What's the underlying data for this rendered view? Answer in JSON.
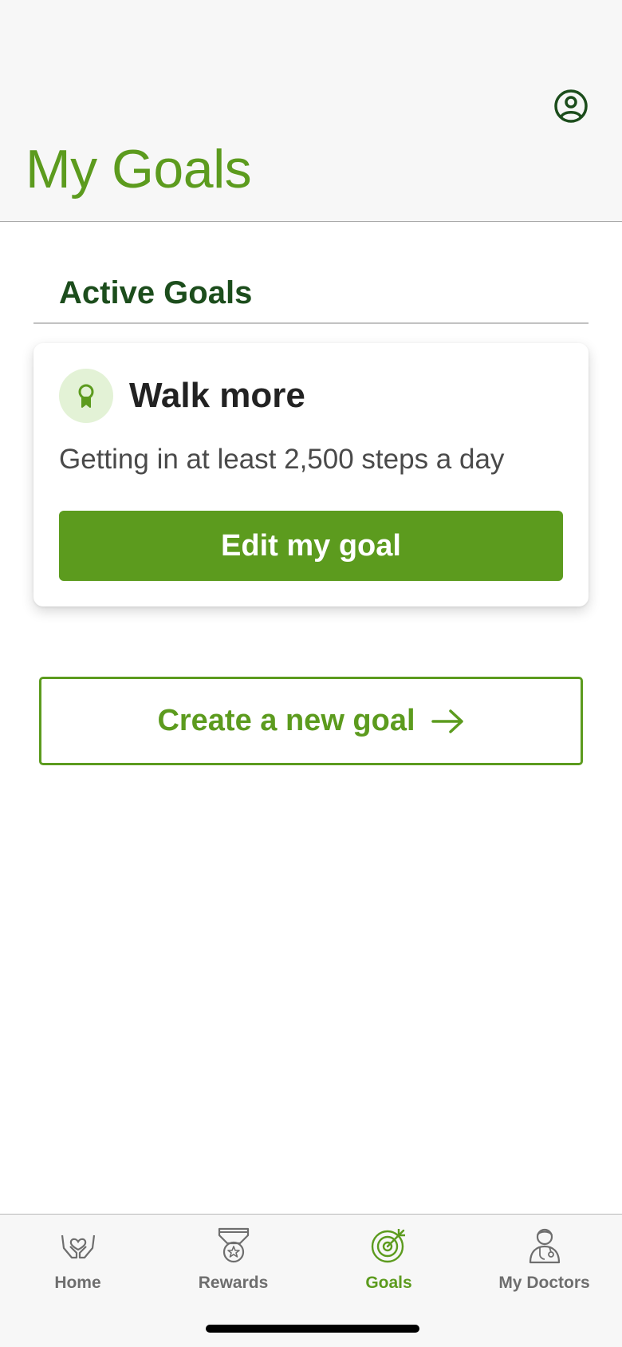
{
  "header": {
    "title": "My Goals",
    "profile_icon": "user-circle-icon"
  },
  "section": {
    "title": "Active Goals"
  },
  "goal_card": {
    "icon": "award-ribbon-icon",
    "title": "Walk more",
    "description": "Getting in at least 2,500 steps a day",
    "edit_label": "Edit my goal"
  },
  "create_goal": {
    "label": "Create a new goal",
    "icon": "arrow-right-icon"
  },
  "tabbar": {
    "items": [
      {
        "label": "Home",
        "icon": "hands-heart-icon",
        "active": false
      },
      {
        "label": "Rewards",
        "icon": "medal-icon",
        "active": false
      },
      {
        "label": "Goals",
        "icon": "target-icon",
        "active": true
      },
      {
        "label": "My Doctors",
        "icon": "doctor-icon",
        "active": false
      }
    ]
  },
  "colors": {
    "brand_green": "#5c9b1e",
    "dark_green": "#1c4d1c",
    "icon_bg_green": "#e3f2d6",
    "inactive_gray": "#6e6e6e"
  }
}
